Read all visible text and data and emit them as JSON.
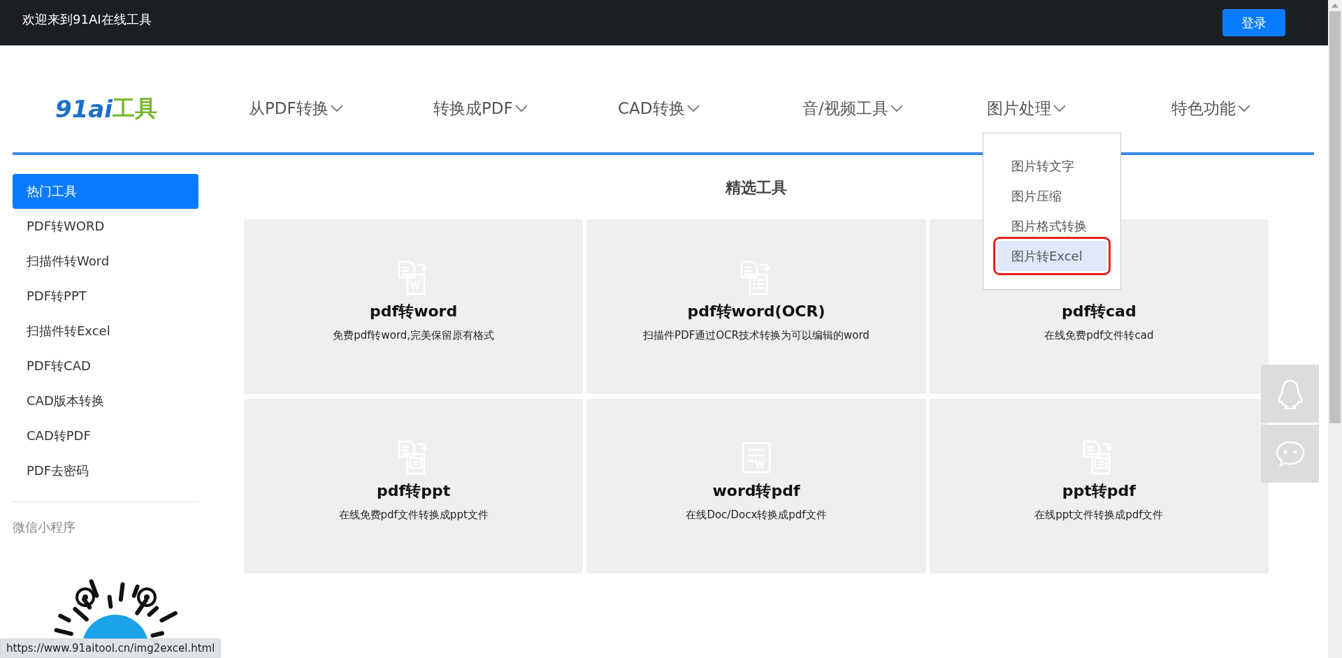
{
  "top_bar": {
    "welcome": "欢迎来到91AI在线工具",
    "login_button": "登录"
  },
  "logo": {
    "mark": "91ai",
    "text": "工具"
  },
  "nav": [
    {
      "label": "从PDF转换"
    },
    {
      "label": "转换成PDF"
    },
    {
      "label": "CAD转换"
    },
    {
      "label": "音/视频工具"
    },
    {
      "label": "图片处理",
      "menu_items": [
        {
          "label": "图片转文字",
          "selected": false
        },
        {
          "label": "图片压缩",
          "selected": false
        },
        {
          "label": "图片格式转换",
          "selected": false
        },
        {
          "label": "图片转Excel",
          "selected": true
        }
      ]
    },
    {
      "label": "特色功能"
    }
  ],
  "sidebar": {
    "items": [
      {
        "label": "热门工具",
        "selected": true
      },
      {
        "label": "PDF转WORD",
        "selected": false
      },
      {
        "label": "扫描件转Word",
        "selected": false
      },
      {
        "label": "PDF转PPT",
        "selected": false
      },
      {
        "label": "扫描件转Excel",
        "selected": false
      },
      {
        "label": "PDF转CAD",
        "selected": false
      },
      {
        "label": "CAD版本转换",
        "selected": false
      },
      {
        "label": "CAD转PDF",
        "selected": false
      },
      {
        "label": "PDF去密码",
        "selected": false
      }
    ],
    "section_title": "微信小程序"
  },
  "main": {
    "title": "精选工具",
    "cards": [
      {
        "title": "pdf转word",
        "description": "免费pdf转word,完美保留原有格式",
        "kind": "convert-word"
      },
      {
        "title": "pdf转word(OCR)",
        "description": "扫描件PDF通过OCR技术转换为可以编辑的word",
        "kind": "convert-form"
      },
      {
        "title": "pdf转cad",
        "description": "在线免费pdf文件转cad"
      },
      {
        "title": "pdf转ppt",
        "description": "在线免费pdf文件转换成ppt文件",
        "kind": "convert-slide"
      },
      {
        "title": "word转pdf",
        "description": "在线Doc/Docx转换成pdf文件",
        "kind": "document"
      },
      {
        "title": "ppt转pdf",
        "description": "在线ppt文件转换成pdf文件",
        "kind": "convert-slide"
      }
    ]
  },
  "status_bar": {
    "url": "https://www.91aitool.cn/img2excel.html"
  }
}
